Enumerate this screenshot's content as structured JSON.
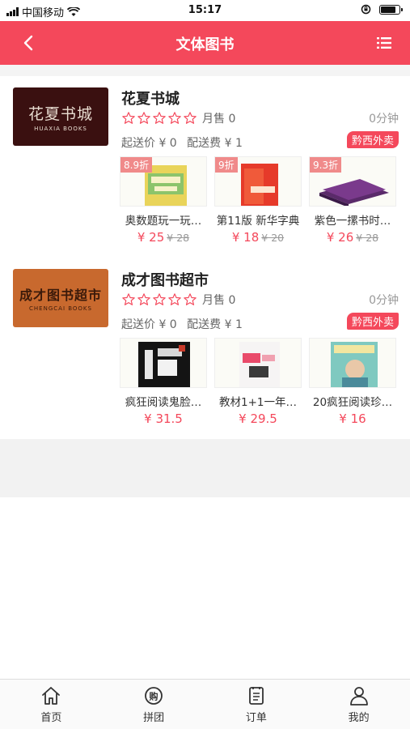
{
  "status_bar": {
    "carrier": "中国移动",
    "time": "15:17",
    "battery_level": 0.85
  },
  "header": {
    "title": "文体图书",
    "back_icon": "chevron-left-icon",
    "menu_icon": "list-menu-icon"
  },
  "stores": [
    {
      "name": "花夏书城",
      "logo_text": "花夏书城",
      "logo_sub": "HUAXIA BOOKS",
      "rating_stars": 0,
      "monthly_sales": "月售 0",
      "delivery_time": "0分钟",
      "min_order": "起送价 ¥ 0",
      "delivery_fee": "配送费 ¥ 1",
      "tag": "黔西外卖",
      "products": [
        {
          "discount": "8.9折",
          "name": "奥数题玩一玩…",
          "price": "¥ 25",
          "old_price": "¥ 28"
        },
        {
          "discount": "9折",
          "name": "第11版 新华字典",
          "price": "¥ 18",
          "old_price": "¥ 20"
        },
        {
          "discount": "9.3折",
          "name": "紫色一摞书时…",
          "price": "¥ 26",
          "old_price": "¥ 28"
        }
      ]
    },
    {
      "name": "成才图书超市",
      "logo_text": "成才图书超市",
      "logo_sub": "CHENGCAI BOOKS",
      "rating_stars": 0,
      "monthly_sales": "月售 0",
      "delivery_time": "0分钟",
      "min_order": "起送价 ¥ 0",
      "delivery_fee": "配送费 ¥ 1",
      "tag": "黔西外卖",
      "products": [
        {
          "discount": "",
          "name": "疯狂阅读鬼脸…",
          "price": "¥ 31.5",
          "old_price": ""
        },
        {
          "discount": "",
          "name": "教材1+1一年…",
          "price": "¥ 29.5",
          "old_price": ""
        },
        {
          "discount": "",
          "name": "20疯狂阅读珍…",
          "price": "¥ 16",
          "old_price": ""
        }
      ]
    }
  ],
  "tabbar": [
    {
      "label": "首页",
      "icon": "home-icon"
    },
    {
      "label": "拼团",
      "icon": "group-buy-icon"
    },
    {
      "label": "订单",
      "icon": "order-list-icon"
    },
    {
      "label": "我的",
      "icon": "profile-icon"
    }
  ],
  "colors": {
    "brand": "#f4485b",
    "discount_badge": "#f08a8a"
  }
}
